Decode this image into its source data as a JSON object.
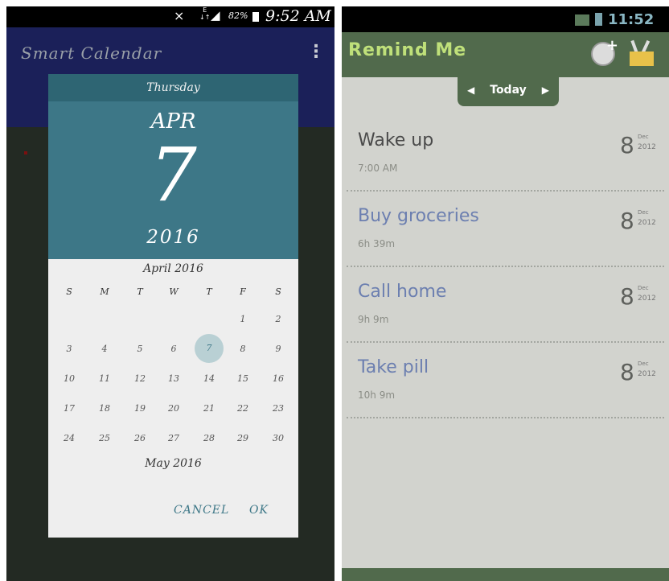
{
  "left_app": {
    "status": {
      "net": "E",
      "net2": "↓↑",
      "battery": "82%",
      "time": "9:52 AM"
    },
    "title": "Smart Calendar",
    "dialog": {
      "weekday": "Thursday",
      "month": "APR",
      "date": "7",
      "year": "2016",
      "calendar_month": "April 2016",
      "weekdays": [
        "S",
        "M",
        "T",
        "W",
        "T",
        "F",
        "S"
      ],
      "weeks": [
        [
          "",
          "",
          "",
          "",
          "",
          "1",
          "2"
        ],
        [
          "3",
          "4",
          "5",
          "6",
          "7",
          "8",
          "9"
        ],
        [
          "10",
          "11",
          "12",
          "13",
          "14",
          "15",
          "16"
        ],
        [
          "17",
          "18",
          "19",
          "20",
          "21",
          "22",
          "23"
        ],
        [
          "24",
          "25",
          "26",
          "27",
          "28",
          "29",
          "30"
        ]
      ],
      "selected": "7",
      "next_month": "May 2016",
      "cancel": "CANCEL",
      "ok": "OK"
    }
  },
  "right_app": {
    "status": {
      "time": "11:52"
    },
    "title": "Remind Me",
    "nav": {
      "label": "Today",
      "prev": "◀",
      "next": "▶"
    },
    "reminders": [
      {
        "title": "Wake up",
        "sub": "7:00 AM",
        "day": "8",
        "month": "Dec",
        "year": "2012",
        "color": "#4a4a4a"
      },
      {
        "title": "Buy groceries",
        "sub": "6h 39m",
        "day": "8",
        "month": "Dec",
        "year": "2012",
        "color": "#6c7fb0"
      },
      {
        "title": "Call home",
        "sub": "9h 9m",
        "day": "8",
        "month": "Dec",
        "year": "2012",
        "color": "#6c7fb0"
      },
      {
        "title": "Take pill",
        "sub": "10h 9m",
        "day": "8",
        "month": "Dec",
        "year": "2012",
        "color": "#6c7fb0"
      }
    ]
  }
}
